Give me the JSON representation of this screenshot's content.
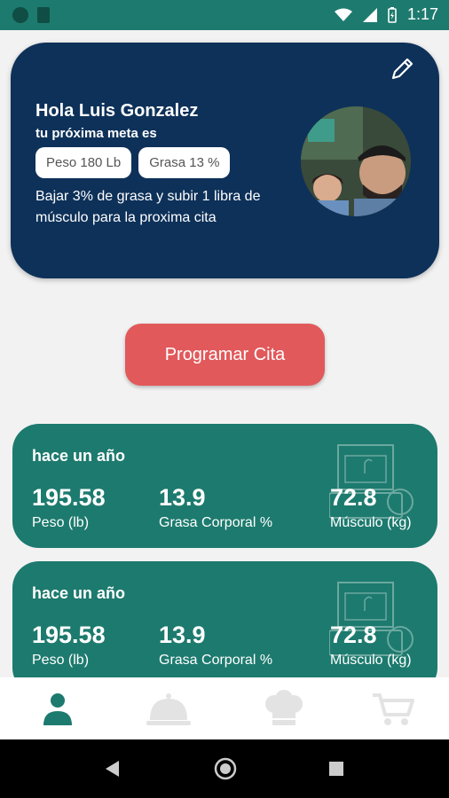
{
  "status_bar": {
    "time": "1:17"
  },
  "hero": {
    "greeting": "Hola Luis Gonzalez",
    "subtitle": "tu próxima meta es",
    "chips": [
      "Peso 180 Lb",
      "Grasa 13 %"
    ],
    "description": "Bajar 3% de grasa y subir 1 libra de músculo para la proxima cita"
  },
  "cta": {
    "label": "Programar Cita"
  },
  "cards": [
    {
      "period": "hace un año",
      "metrics": [
        {
          "value": "195.58",
          "label": "Peso (lb)"
        },
        {
          "value": "13.9",
          "label": "Grasa Corporal %"
        },
        {
          "value": "72.8",
          "label": "Músculo (kg)"
        }
      ]
    },
    {
      "period": "hace un año",
      "metrics": [
        {
          "value": "195.58",
          "label": "Peso (lb)"
        },
        {
          "value": "13.9",
          "label": "Grasa Corporal %"
        },
        {
          "value": "72.8",
          "label": "Músculo (kg)"
        }
      ]
    }
  ],
  "bottom_nav": {
    "items": [
      {
        "icon": "user-icon",
        "active": true
      },
      {
        "icon": "cloche-icon",
        "active": false
      },
      {
        "icon": "chef-hat-icon",
        "active": false
      },
      {
        "icon": "cart-icon",
        "active": false
      }
    ]
  },
  "colors": {
    "accent": "#1d7a6e",
    "hero_bg": "#0e3159",
    "cta": "#e2595b",
    "nav_active": "#1d7a6e",
    "nav_inactive": "#e3e3e3"
  }
}
